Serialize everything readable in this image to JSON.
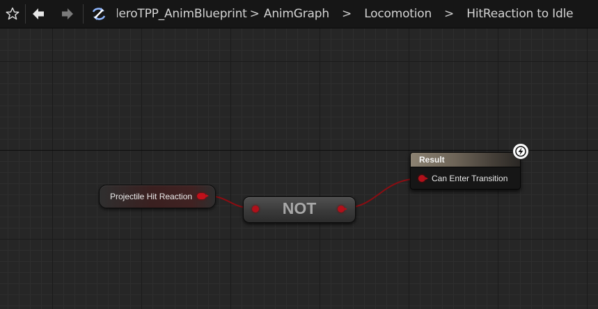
{
  "toolbar": {
    "breadcrumbs": [
      {
        "label": "HeroTPP_AnimBlueprint"
      },
      {
        "label": "AnimGraph"
      },
      {
        "label": "Locomotion"
      },
      {
        "label": "HitReaction to Idle"
      }
    ],
    "breadcrumb_visible": [
      "leroTPP_AnimBlueprint",
      "AnimGraph",
      "Locomotion",
      "HitReaction to Idle"
    ],
    "separator_glyph": ">"
  },
  "graph": {
    "variable_node": {
      "label": "Projectile Hit Reaction"
    },
    "not_node": {
      "label": "NOT"
    },
    "result_node": {
      "header": "Result",
      "pin_label": "Can Enter Transition"
    }
  },
  "colors": {
    "bool_pin": "#c0101a",
    "wire": "#8a0d12",
    "graph_bg": "#262626",
    "result_header": "#8c8272"
  },
  "icons": {
    "favorite": "star-icon",
    "back": "back-arrow-icon",
    "forward": "forward-arrow-icon",
    "sync": "browse-sync-icon",
    "transition": "lightning-bolt-icon"
  }
}
